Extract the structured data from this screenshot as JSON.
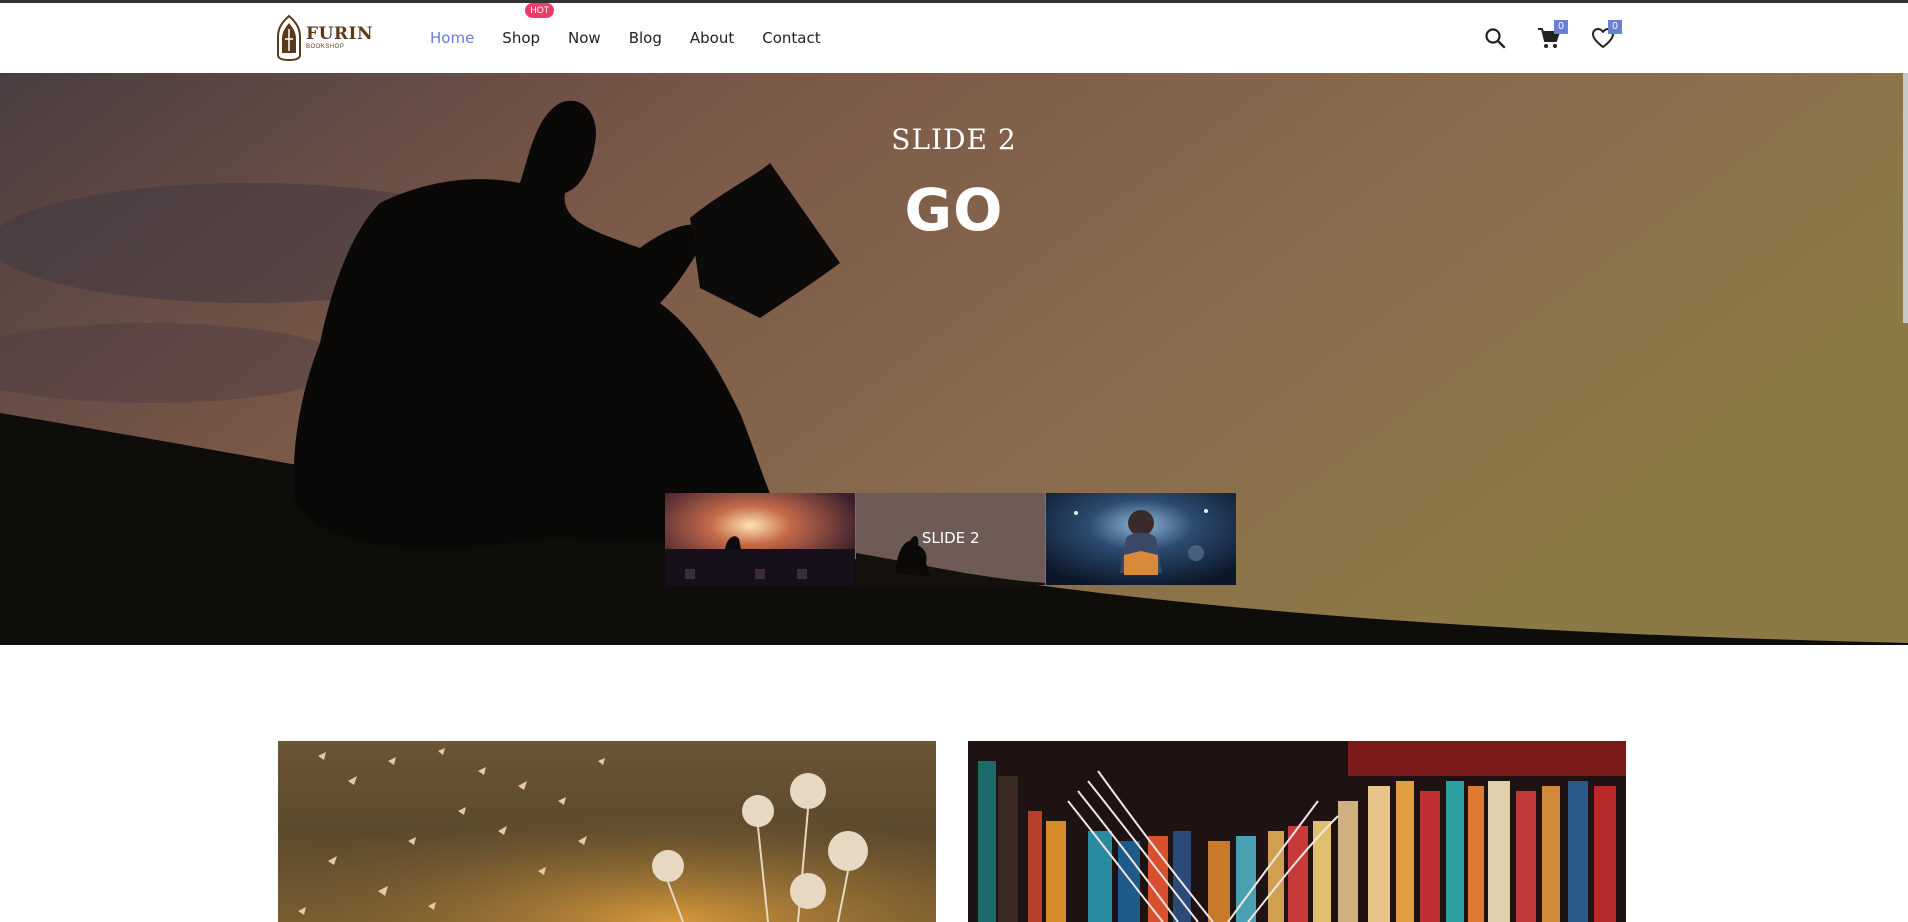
{
  "header": {
    "logo": {
      "name": "FURIN",
      "subtitle": "BOOKSHOP"
    },
    "nav": [
      {
        "label": "Home",
        "active": true
      },
      {
        "label": "Shop",
        "badge": "HOT"
      },
      {
        "label": "Now"
      },
      {
        "label": "Blog"
      },
      {
        "label": "About"
      },
      {
        "label": "Contact"
      }
    ],
    "icons": {
      "search": "search-icon",
      "cart": {
        "icon": "cart-icon",
        "count": "0"
      },
      "wishlist": {
        "icon": "heart-icon",
        "count": "0"
      }
    }
  },
  "hero": {
    "subtitle": "SLIDE 2",
    "title": "GO",
    "thumbnails": [
      {
        "label": ""
      },
      {
        "label": "SLIDE 2",
        "active": true
      },
      {
        "label": ""
      }
    ]
  },
  "colors": {
    "accent": "#6a7fd6",
    "hot_badge": "#ef3b6a",
    "logo_brown": "#5b3a1a"
  }
}
